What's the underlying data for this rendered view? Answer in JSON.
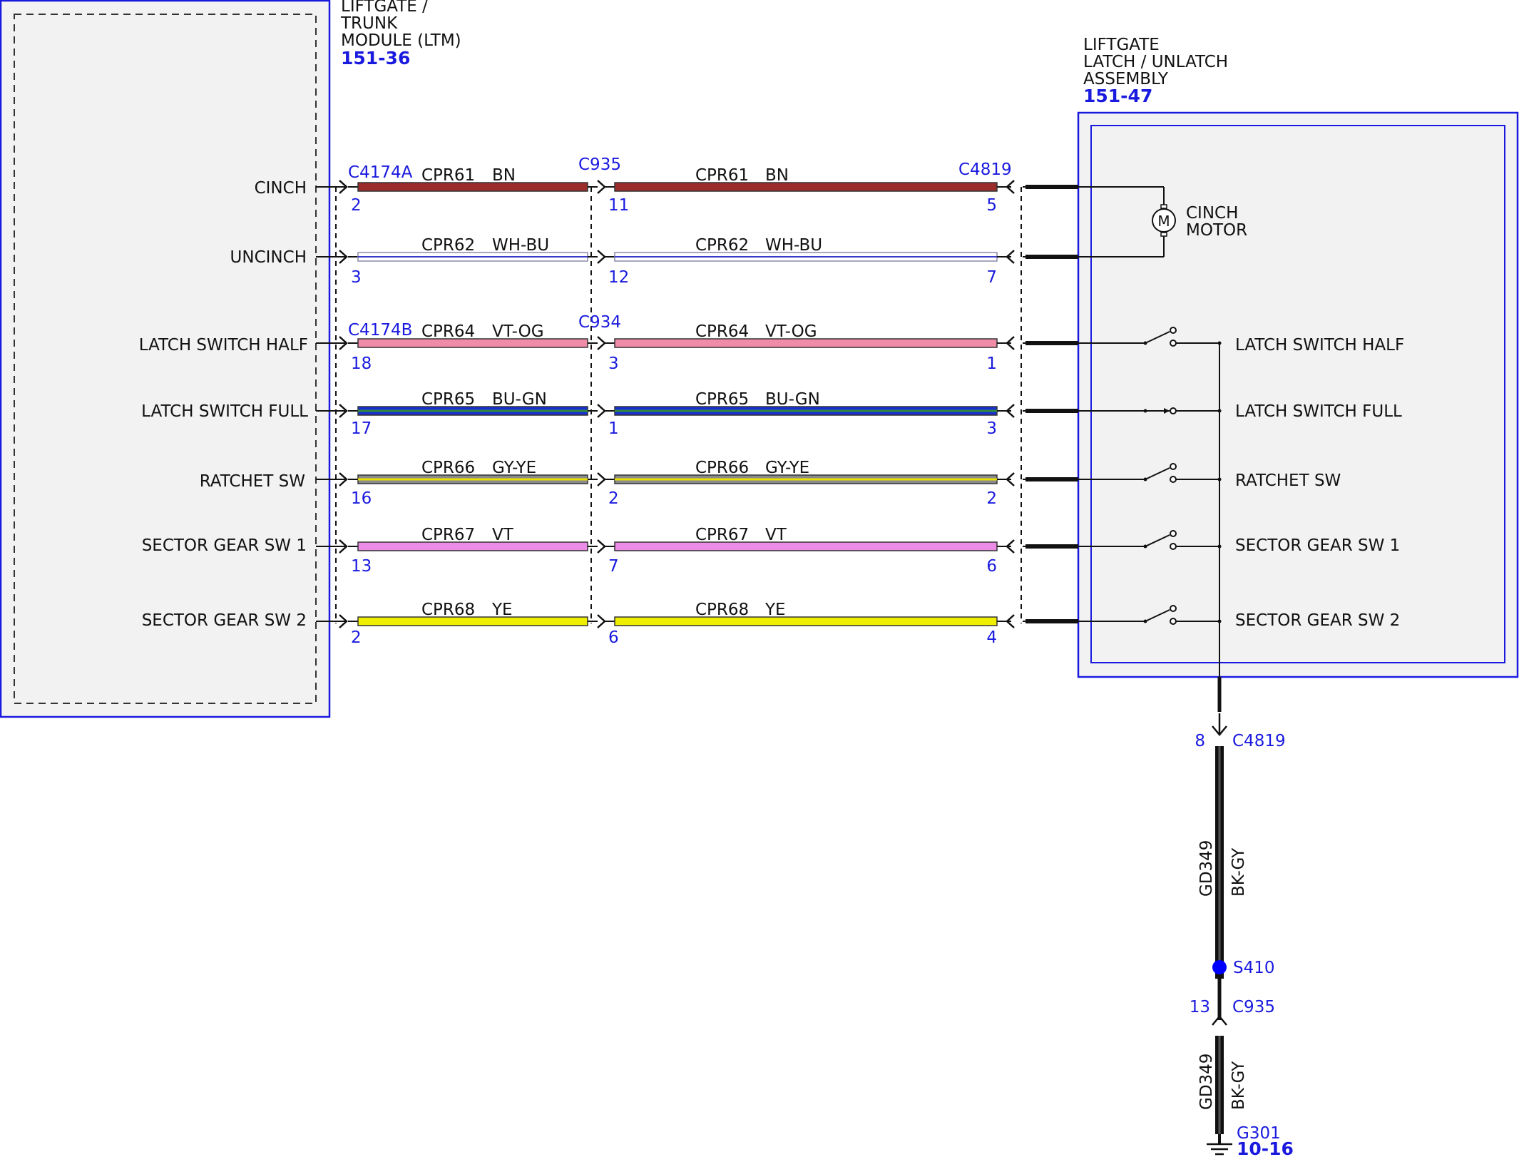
{
  "ltm": {
    "title": [
      "LIFTGATE /",
      "TRUNK",
      "MODULE (LTM)"
    ],
    "ref": "151-36",
    "pins": [
      "CINCH",
      "UNCINCH",
      "LATCH SWITCH HALF",
      "LATCH SWITCH FULL",
      "RATCHET SW",
      "SECTOR GEAR SW 1",
      "SECTOR GEAR SW 2"
    ]
  },
  "latch": {
    "title": [
      "LIFTGATE",
      "LATCH / UNLATCH",
      "ASSEMBLY"
    ],
    "ref": "151-47",
    "motor": [
      "CINCH",
      "MOTOR"
    ],
    "motor_symbol": "M",
    "switches": [
      "LATCH SWITCH HALF",
      "LATCH SWITCH FULL",
      "RATCHET SW",
      "SECTOR GEAR SW 1",
      "SECTOR GEAR SW 2"
    ]
  },
  "connectors": {
    "ltm_a": "C4174A",
    "ltm_b": "C4174B",
    "inline_a": "C935",
    "inline_b": "C934",
    "latch": "C4819"
  },
  "wires": [
    {
      "circuit": "CPR61",
      "color": "BN",
      "pin_ltm": "2",
      "pin_inline": "11",
      "pin_latch": "5",
      "hex": "#9b2c2c",
      "stripe": "#9b2c2c"
    },
    {
      "circuit": "CPR62",
      "color": "WH-BU",
      "pin_ltm": "3",
      "pin_inline": "12",
      "pin_latch": "7",
      "hex": "#ffffff",
      "stripe": "#3a3ac8"
    },
    {
      "circuit": "CPR64",
      "color": "VT-OG",
      "pin_ltm": "18",
      "pin_inline": "3",
      "pin_latch": "1",
      "hex": "#f08ca8",
      "stripe": "#f08ca8"
    },
    {
      "circuit": "CPR65",
      "color": "BU-GN",
      "pin_ltm": "17",
      "pin_inline": "1",
      "pin_latch": "3",
      "hex": "#1a2fd0",
      "stripe": "#2e8b3a"
    },
    {
      "circuit": "CPR66",
      "color": "GY-YE",
      "pin_ltm": "16",
      "pin_inline": "2",
      "pin_latch": "2",
      "hex": "#8a8a8a",
      "stripe": "#e8e000"
    },
    {
      "circuit": "CPR67",
      "color": "VT",
      "pin_ltm": "13",
      "pin_inline": "7",
      "pin_latch": "6",
      "hex": "#ec8ce6",
      "stripe": "#ec8ce6"
    },
    {
      "circuit": "CPR68",
      "color": "YE",
      "pin_ltm": "2",
      "pin_inline": "6",
      "pin_latch": "4",
      "hex": "#f0ee00",
      "stripe": "#f0ee00"
    }
  ],
  "ground": {
    "pin_c4819": "8",
    "conn_c4819": "C4819",
    "wire1_circuit": "GD349",
    "wire1_color": "BK-GY",
    "splice": "S410",
    "pin_c935": "13",
    "conn_c935": "C935",
    "wire2_circuit": "GD349",
    "wire2_color": "BK-GY",
    "ground_point": "G301",
    "ground_ref": "10-16"
  },
  "colors": {
    "module_border": "#1a1adf",
    "module_fill": "#f2f2f2",
    "text_blue": "#1a1adf",
    "splice_dot": "#0000ff"
  }
}
